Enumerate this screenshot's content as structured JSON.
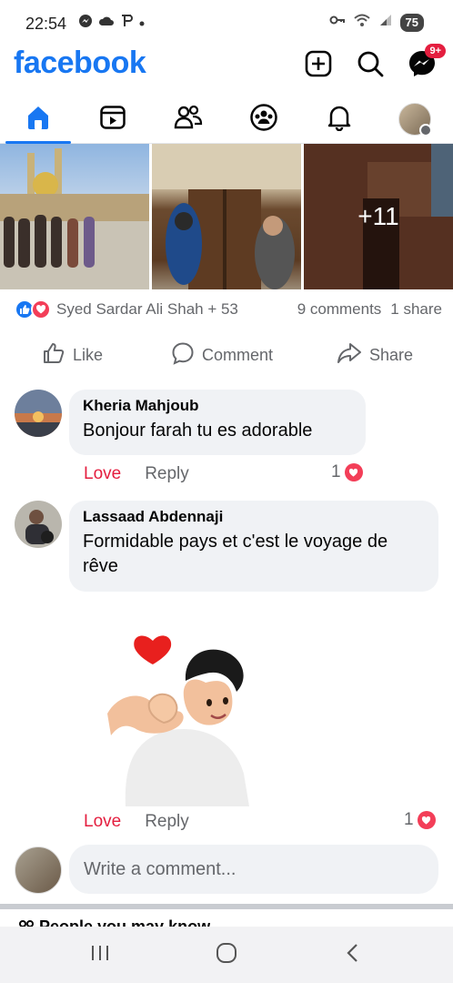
{
  "status_bar": {
    "time": "22:54",
    "left_icons": [
      "messenger-icon",
      "cloud-icon",
      "p-icon",
      "dot-icon"
    ],
    "right_icons": [
      "key-icon",
      "wifi-icon",
      "signal-icon"
    ],
    "battery": "75"
  },
  "header": {
    "logo": "facebook",
    "messenger_badge": "9+"
  },
  "nav_tabs": [
    {
      "name": "home",
      "active": true
    },
    {
      "name": "video",
      "active": false
    },
    {
      "name": "friends",
      "active": false
    },
    {
      "name": "groups",
      "active": false
    },
    {
      "name": "notifications",
      "active": false
    },
    {
      "name": "menu-profile",
      "active": false
    }
  ],
  "post": {
    "more_photos": "+11",
    "reactions": {
      "names": "Syed Sardar Ali Shah + 53",
      "comments": "9 comments",
      "shares": "1 share"
    },
    "actions": {
      "like": "Like",
      "comment": "Comment",
      "share": "Share"
    }
  },
  "comments": [
    {
      "author": "Kheria Mahjoub",
      "text": "Bonjour farah tu es adorable",
      "love_label": "Love",
      "reply_label": "Reply",
      "reaction_count": "1"
    },
    {
      "author": "Lassaad Abdennaji",
      "text": "Formidable pays et c'est le voyage de rêve",
      "love_label": "Love",
      "reply_label": "Reply",
      "reaction_count": "1"
    }
  ],
  "composer": {
    "placeholder": "Write a comment..."
  },
  "next_section": {
    "title": "People you may know"
  },
  "colors": {
    "brand": "#1877f2",
    "love": "#e41e3f",
    "bubble": "#f0f2f5",
    "muted_text": "#65676b"
  }
}
